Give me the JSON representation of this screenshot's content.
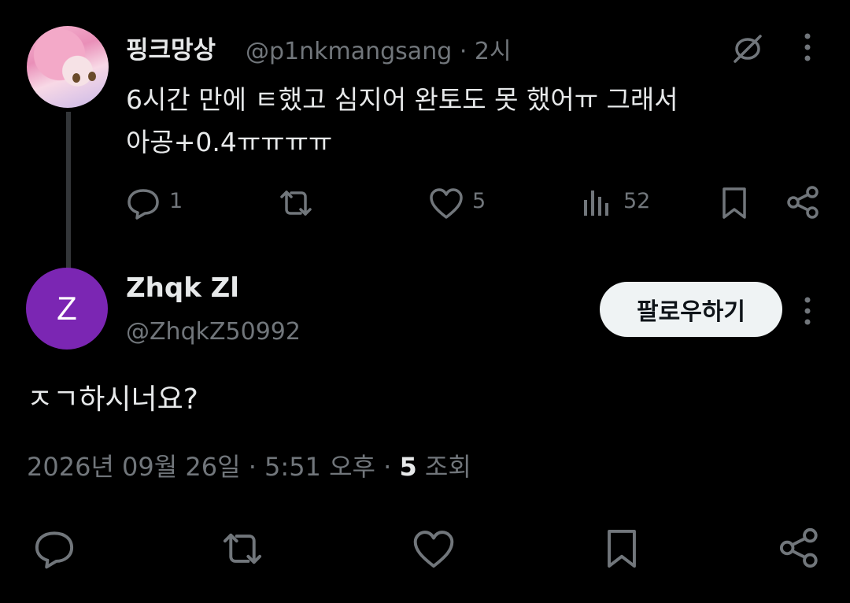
{
  "parent": {
    "display_name": "핑크망상",
    "handle": "@p1nkmangsang",
    "separator": "·",
    "time": "2시",
    "text_line1": "6시간 만에 ㅌ했고 심지어 완토도 못 했어ㅠ 그래서",
    "text_line2": "아공+0.4ㅠㅠㅠㅠ",
    "reply_count": "1",
    "like_count": "5",
    "view_count": "52",
    "icons": [
      "grok-icon",
      "more-icon",
      "reply-icon",
      "retweet-icon",
      "like-icon",
      "views-icon",
      "bookmark-icon",
      "share-icon"
    ]
  },
  "reply": {
    "avatar_letter": "Z",
    "avatar_color": "#7b26b3",
    "display_name": "Zhqk Zl",
    "handle": "@ZhqkZ50992",
    "follow_label": "팔로우하기",
    "text": "ㅈㄱ하시너요?",
    "date": "2026년 09월 26일 · 5:51 오후 ·",
    "views_number": "5",
    "views_label": "조회",
    "icons": [
      "reply-icon",
      "retweet-icon",
      "like-icon",
      "bookmark-icon",
      "share-icon"
    ]
  },
  "colors": {
    "background": "#000000",
    "text": "#e7e9ea",
    "muted": "#71767b",
    "line": "#333639"
  }
}
